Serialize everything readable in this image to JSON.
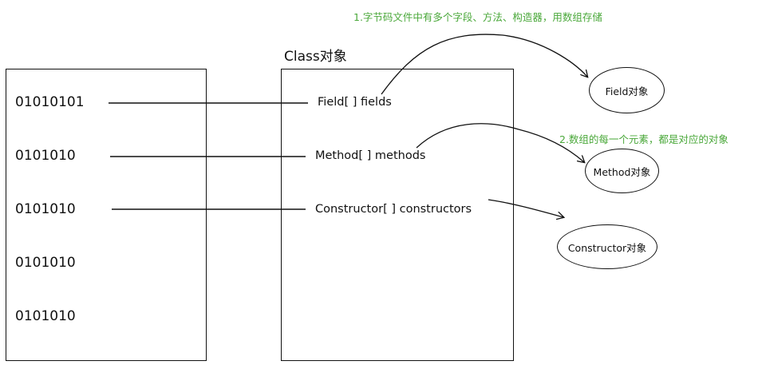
{
  "title": "Class对象",
  "bytecode": [
    "01010101",
    "0101010",
    "0101010",
    "0101010",
    "0101010"
  ],
  "members": {
    "fields": "Field[ ] fields",
    "methods": "Method[ ] methods",
    "constructors": "Constructor[ ] constructors"
  },
  "notes": {
    "note1": "1.字节码文件中有多个字段、方法、构造器，用数组存储",
    "note2": "2.数组的每一个元素，都是对应的对象"
  },
  "objects": {
    "field": "Field对象",
    "method": "Method对象",
    "constructor": "Constructor对象"
  },
  "colors": {
    "note": "#4aa83a",
    "stroke": "#111111"
  }
}
